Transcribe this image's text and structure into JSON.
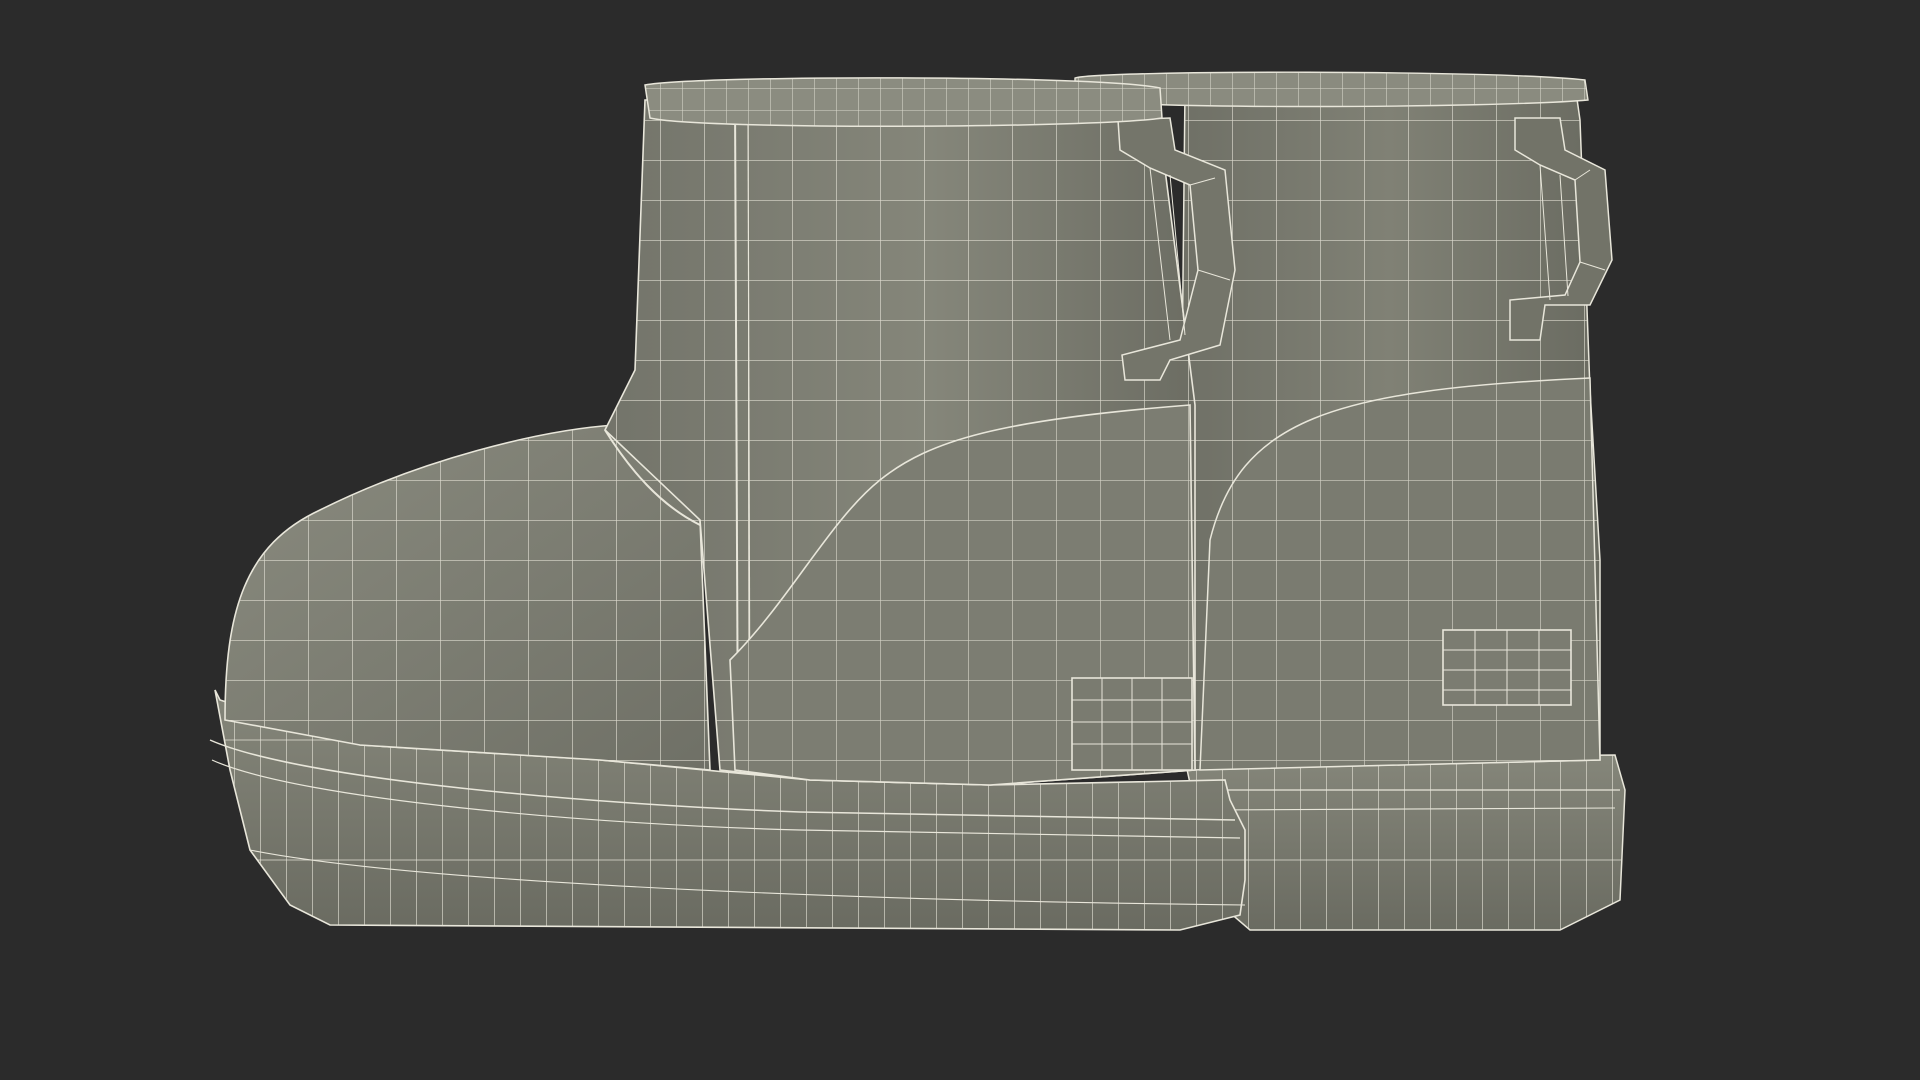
{
  "scene": {
    "subject": "pair-of-ankle-boots-wireframe",
    "colors": {
      "background": "#2b2b2b",
      "mesh_fill": "#7d7e72",
      "mesh_fill_light": "#8c8d81",
      "mesh_fill_dark": "#66675d",
      "wire": "#e8e6da"
    }
  }
}
